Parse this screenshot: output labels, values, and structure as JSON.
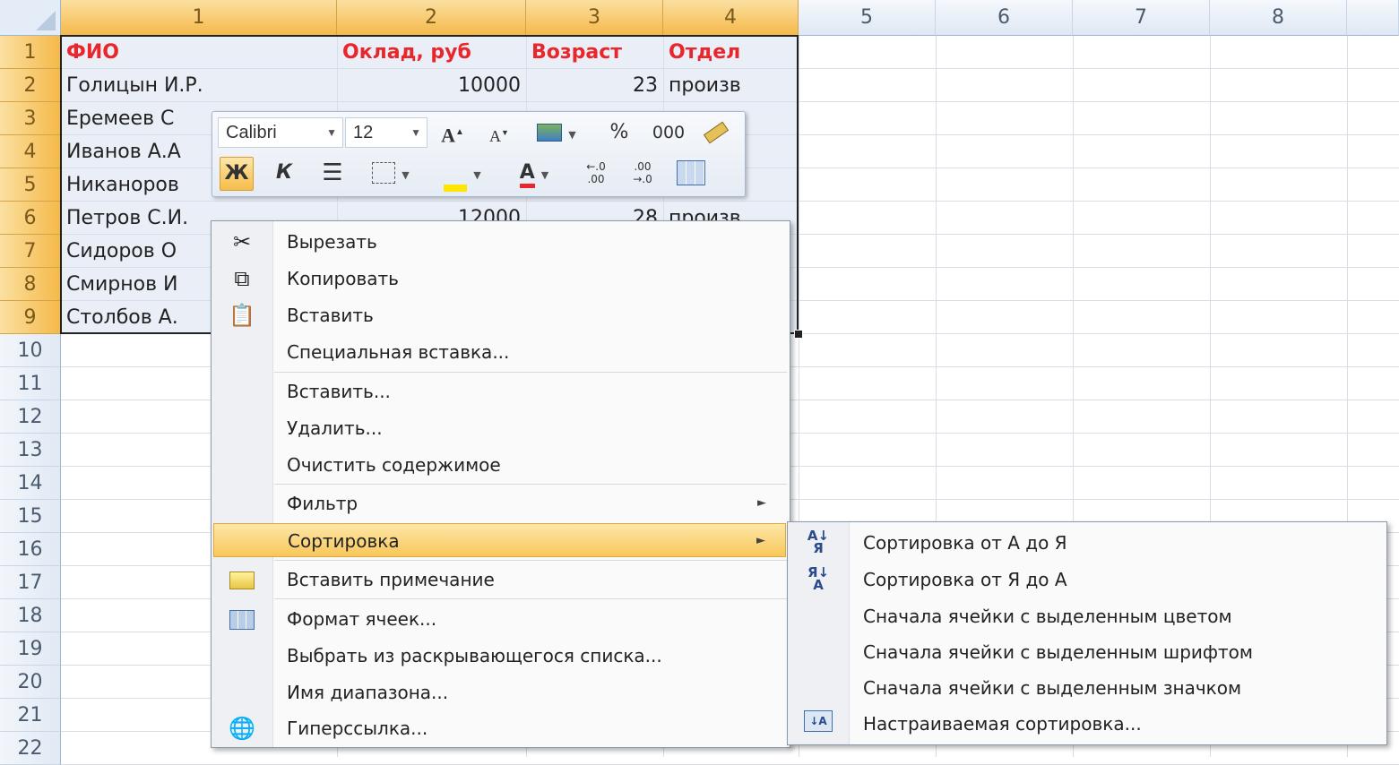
{
  "columns": [
    "1",
    "2",
    "3",
    "4",
    "5",
    "6",
    "7",
    "8"
  ],
  "rows": [
    "1",
    "2",
    "3",
    "4",
    "5",
    "6",
    "7",
    "8",
    "9",
    "10",
    "11",
    "12",
    "13",
    "14",
    "15",
    "16",
    "17",
    "18",
    "19",
    "20",
    "21",
    "22"
  ],
  "table": {
    "headers": [
      "ФИО",
      "Оклад, руб",
      "Возраст",
      "Отдел"
    ],
    "visible": [
      [
        "Голицын И.Р.",
        "10000",
        "23",
        "произв"
      ],
      [
        "Еремеев С",
        "",
        "",
        ""
      ],
      [
        "Иванов А.А",
        "",
        "",
        ""
      ],
      [
        "Никаноров",
        "",
        "",
        ""
      ],
      [
        "Петров С.И.",
        "12000",
        "28",
        "произв"
      ],
      [
        "Сидоров О",
        "",
        "",
        ""
      ],
      [
        "Смирнов И",
        "",
        "",
        ""
      ],
      [
        "Столбов А.",
        "",
        "",
        ""
      ]
    ]
  },
  "mini_toolbar": {
    "font_name": "Calibri",
    "font_size": "12",
    "percent": "%",
    "thousands": "000",
    "bold": "Ж",
    "italic": "К",
    "font_color_letter": "A",
    "grow_font": "A",
    "shrink_font": "A"
  },
  "context_menu": {
    "items": [
      {
        "label": "Вырезать",
        "icon": "scissors-icon"
      },
      {
        "label": "Копировать",
        "icon": "copy-icon"
      },
      {
        "label": "Вставить",
        "icon": "paste-icon"
      },
      {
        "label": "Специальная вставка...",
        "icon": ""
      },
      {
        "label": "Вставить...",
        "icon": ""
      },
      {
        "label": "Удалить...",
        "icon": ""
      },
      {
        "label": "Очистить содержимое",
        "icon": ""
      },
      {
        "label": "Фильтр",
        "icon": "",
        "submenu": true
      },
      {
        "label": "Сортировка",
        "icon": "",
        "submenu": true,
        "highlighted": true
      },
      {
        "label": "Вставить примечание",
        "icon": "comment-icon"
      },
      {
        "label": "Формат ячеек...",
        "icon": "format-cells-icon"
      },
      {
        "label": "Выбрать из раскрывающегося списка...",
        "icon": ""
      },
      {
        "label": "Имя диапазона...",
        "icon": ""
      },
      {
        "label": "Гиперссылка...",
        "icon": "hyperlink-icon"
      }
    ],
    "submenu_arrow": "►"
  },
  "sort_submenu": {
    "items": [
      {
        "label": "Сортировка от А до Я",
        "icon": "sort-az-icon"
      },
      {
        "label": "Сортировка от Я до А",
        "icon": "sort-za-icon"
      },
      {
        "label": "Сначала ячейки с выделенным цветом",
        "icon": ""
      },
      {
        "label": "Сначала ячейки с выделенным шрифтом",
        "icon": ""
      },
      {
        "label": "Сначала ячейки с выделенным значком",
        "icon": ""
      },
      {
        "label": "Настраиваемая сортировка...",
        "icon": "custom-sort-icon"
      }
    ]
  },
  "colors": {
    "header_text": "#e8262b",
    "selection_fill": "#e9eef7",
    "menu_highlight": "#f8c75a",
    "selected_header": "#f5b94a"
  }
}
